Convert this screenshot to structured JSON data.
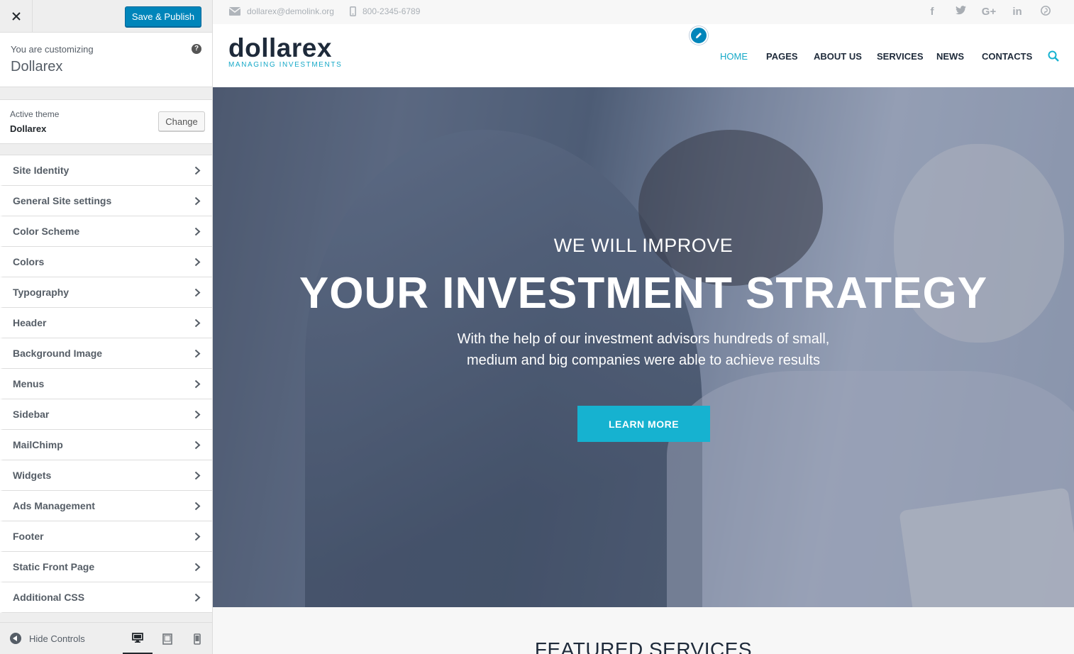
{
  "sidebar": {
    "save_label": "Save & Publish",
    "customizing_label": "You are customizing",
    "site_name": "Dollarex",
    "help_glyph": "?",
    "active_theme_label": "Active theme",
    "active_theme_name": "Dollarex",
    "change_label": "Change",
    "sections": [
      "Site Identity",
      "General Site settings",
      "Color Scheme",
      "Colors",
      "Typography",
      "Header",
      "Background Image",
      "Menus",
      "Sidebar",
      "MailChimp",
      "Widgets",
      "Ads Management",
      "Footer",
      "Static Front Page",
      "Additional CSS"
    ],
    "hide_controls_label": "Hide Controls",
    "devices": [
      "desktop-icon",
      "tablet-icon",
      "mobile-icon"
    ],
    "active_device": "desktop"
  },
  "preview": {
    "topbar": {
      "email": "dollarex@demolink.org",
      "phone": "800-2345-6789",
      "socials": [
        "f",
        "t",
        "G+",
        "in",
        "p"
      ]
    },
    "logo": {
      "word": "dollarex",
      "tagline": "MANAGING INVESTMENTS"
    },
    "nav": [
      "HOME",
      "PAGES",
      "ABOUT US",
      "SERVICES",
      "NEWS",
      "CONTACTS"
    ],
    "active_nav": "HOME",
    "hero": {
      "subtitle": "WE WILL IMPROVE",
      "title": "YOUR INVESTMENT STRATEGY",
      "desc_line1": "With the help of our investment advisors hundreds of small,",
      "desc_line2": "medium and big companies were able to achieve results",
      "button": "LEARN MORE"
    },
    "featured_title": "FEATURED SERVICES"
  },
  "colors": {
    "accent": "#16b2d0",
    "wp_primary": "#0085ba",
    "logo_dark": "#1e2a3a"
  }
}
